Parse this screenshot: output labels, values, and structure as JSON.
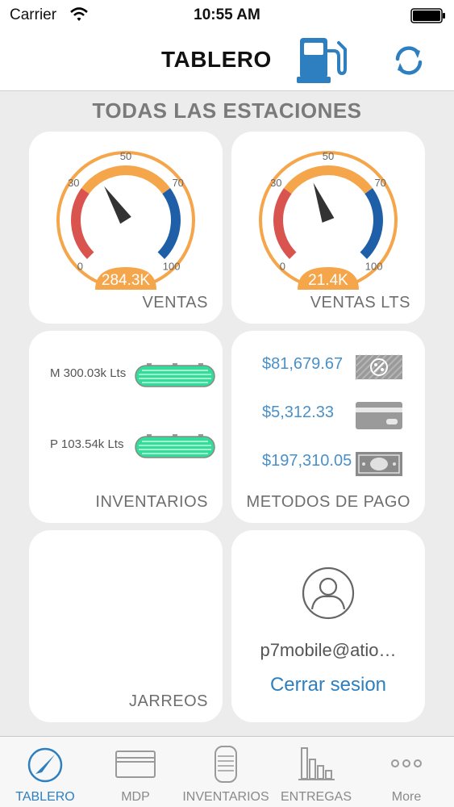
{
  "status_bar": {
    "carrier": "Carrier",
    "time": "10:55 AM"
  },
  "header": {
    "title": "TABLERO"
  },
  "section_title": "TODAS LAS ESTACIONES",
  "gauges": [
    {
      "label": "VENTAS",
      "value_text": "284.3K",
      "needle": 38,
      "ticks": [
        "0",
        "30",
        "50",
        "70",
        "100"
      ]
    },
    {
      "label": "VENTAS LTS",
      "value_text": "21.4K",
      "needle": 42,
      "ticks": [
        "0",
        "30",
        "50",
        "70",
        "100"
      ]
    }
  ],
  "inventory": {
    "label": "INVENTARIOS",
    "items": [
      {
        "text": "M 300.03k Lts",
        "level": 1.0
      },
      {
        "text": "P 103.54k Lts",
        "level": 1.0
      }
    ]
  },
  "payments": {
    "label": "METODOS DE PAGO",
    "items": [
      {
        "amount": "$81,679.67",
        "icon": "voucher-icon"
      },
      {
        "amount": "$5,312.33",
        "icon": "credit-card-icon"
      },
      {
        "amount": "$197,310.05",
        "icon": "cash-icon"
      }
    ]
  },
  "jarreos": {
    "label": "JARREOS"
  },
  "user": {
    "email": "p7mobile@atio…",
    "logout": "Cerrar sesion"
  },
  "tabs": [
    {
      "label": "TABLERO",
      "icon": "speedometer-icon"
    },
    {
      "label": "MDP",
      "icon": "card-icon"
    },
    {
      "label": "INVENTARIOS",
      "icon": "tank-icon"
    },
    {
      "label": "ENTREGAS",
      "icon": "bar-chart-icon"
    },
    {
      "label": "More",
      "icon": "more-icon"
    }
  ],
  "colors": {
    "accent": "#2e7fc0",
    "gauge_orange": "#f5a54a",
    "gauge_red": "#d9534f",
    "gauge_blue": "#1f5fa8",
    "tank_green": "#33dd99",
    "amount_blue": "#4a90c8"
  }
}
